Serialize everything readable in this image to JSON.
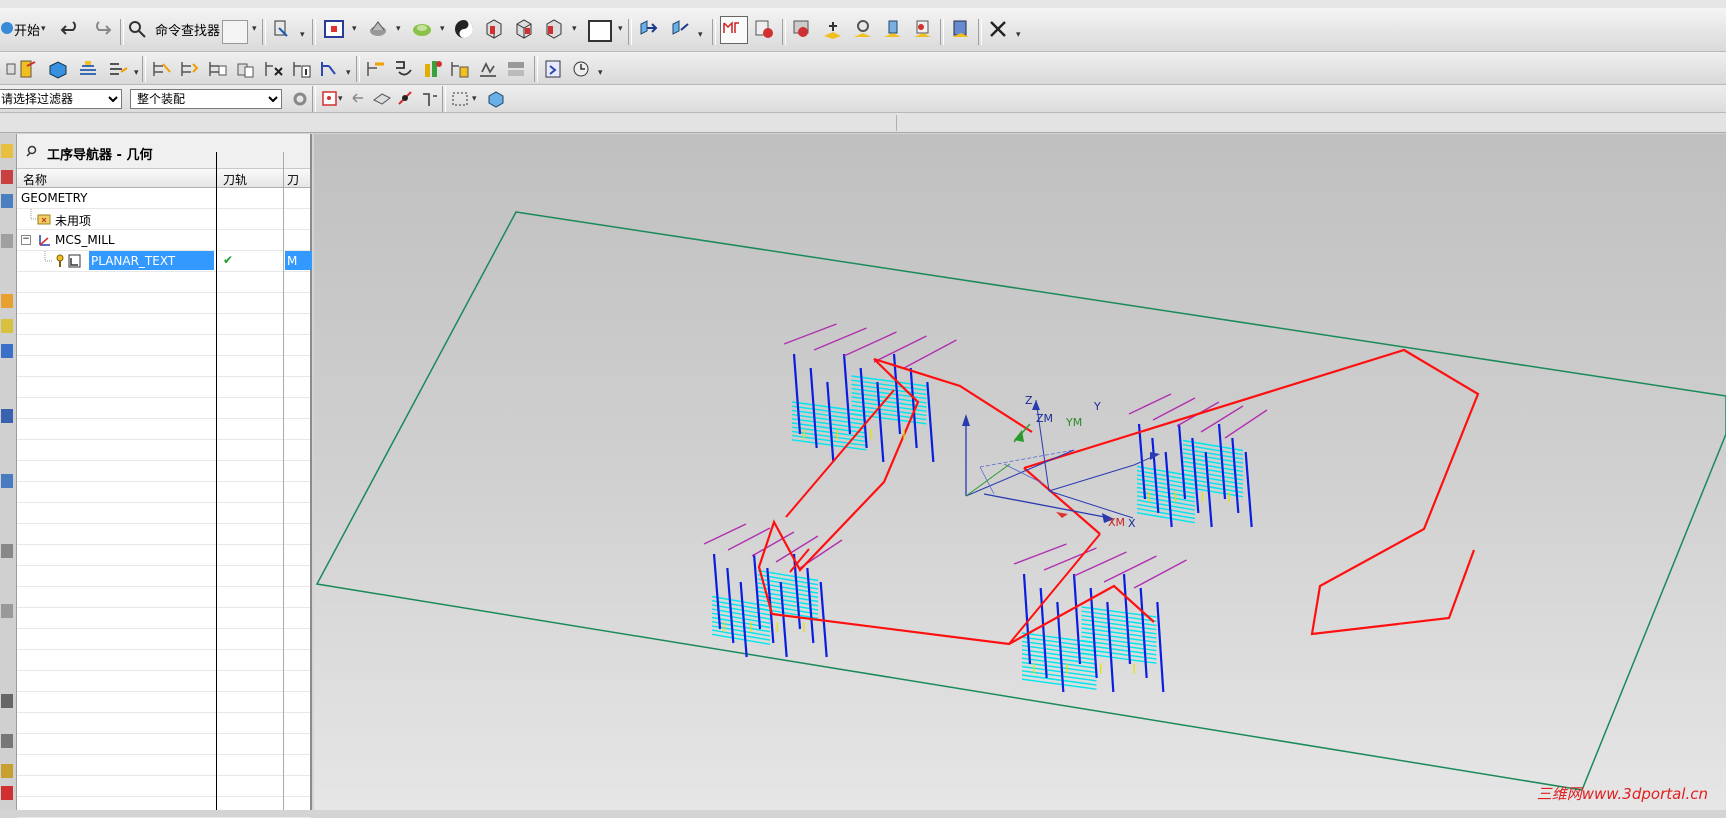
{
  "toolbar1": {
    "start_label": "开始",
    "command_finder_label": "命令查找器"
  },
  "toolbar3": {
    "selection_filter": "请选择过滤器",
    "assembly_scope": "整个装配"
  },
  "navigator": {
    "title": "工序导航器 - 几何",
    "columns": [
      "名称",
      "刀轨",
      "刀"
    ],
    "rows": [
      {
        "name": "GEOMETRY",
        "toolpath": "",
        "col3": ""
      },
      {
        "name": "未用项",
        "toolpath": "",
        "col3": ""
      },
      {
        "name": "MCS_MILL",
        "toolpath": "",
        "col3": ""
      },
      {
        "name": "PLANAR_TEXT",
        "toolpath": "✔",
        "col3": "M"
      }
    ]
  },
  "viewport": {
    "axis_labels": {
      "z": "Z",
      "zm": "ZM",
      "ym": "YM",
      "y": "Y",
      "xm": "XM",
      "x": "X"
    },
    "watermark": "三维网www.3dportal.cn"
  },
  "colors": {
    "toolpath_cut": "#00e5ee",
    "toolpath_plunge": "#0a1ee0",
    "toolpath_rapid": "#ff1010",
    "toolpath_engage": "#b030b0",
    "toolpath_step": "#e8e000",
    "boundary": "#1a8a5a",
    "selection": "#3399ff"
  }
}
